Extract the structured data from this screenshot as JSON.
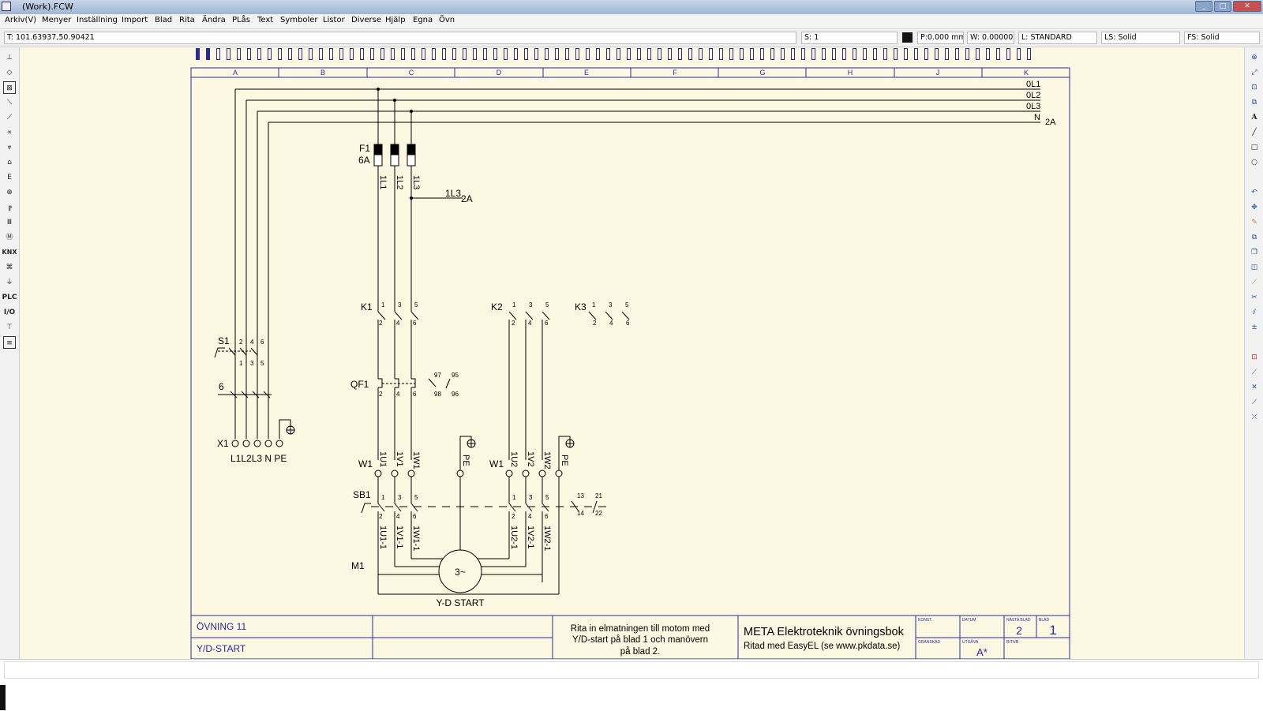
{
  "window": {
    "title": "(Work).FCW"
  },
  "menu": [
    "Arkiv(V)",
    "Menyer",
    "Inställning",
    "Import",
    "Blad",
    "Rita",
    "Ändra",
    "PLås",
    "Text",
    "Symboler",
    "Listor",
    "Diverse",
    "Hjälp",
    "Egna",
    "Övn"
  ],
  "status": {
    "coord": "T: 101.63937,50.90421",
    "scale": "S: 1",
    "pen": "P:0.000 mm",
    "width": "W: 0.00000",
    "layer": "L: STANDARD",
    "line_style": "LS: Solid",
    "fill_style": "FS: Solid"
  },
  "left_tools": [
    "pin-icon",
    "component-icon",
    "terminal-icon",
    "switch-icon",
    "contact-icon",
    "relay-icon",
    "fuse-icon",
    "lamp-icon",
    "transformer-icon",
    "socket-icon",
    "busbar-icon",
    "terminal-strip-icon",
    "motor-icon",
    "KNX",
    "sensor-icon",
    "plug-icon",
    "PLC",
    "I/O",
    "connector-icon",
    "list-icon"
  ],
  "right_tools": [
    "zoom-in-icon",
    "zoom-fit-icon",
    "zoom-window-icon",
    "zoom-prev-icon",
    "text-icon",
    "line-icon",
    "rectangle-icon",
    "circle-icon",
    "undo-icon",
    "move-icon",
    "pencil-icon",
    "copy-icon",
    "duplicate-icon",
    "mirror-icon",
    "measure-icon",
    "trim-icon",
    "split-icon",
    "numbering-icon",
    "snap-icon",
    "snap-end-icon",
    "snap-intersect-icon",
    "snap-near-icon",
    "snap-off-icon"
  ],
  "drawing": {
    "columns": [
      "A",
      "B",
      "C",
      "D",
      "E",
      "F",
      "G",
      "H",
      "J",
      "K"
    ],
    "bus_labels": [
      "0L1",
      "0L2",
      "0L3",
      "N"
    ],
    "bus_rating": "2A",
    "fuse_tag": "F1",
    "fuse_rating": "6A",
    "fuse_outputs": [
      "1L1",
      "1L2",
      "1L3"
    ],
    "branch_label": "1L3",
    "branch_rating": "2A",
    "k1": "K1",
    "k2": "K2",
    "k3": "K3",
    "top_nums": [
      "1",
      "3",
      "5"
    ],
    "bottom_nums": [
      "2",
      "4",
      "6"
    ],
    "s1": "S1",
    "s1_top_nums": [
      "2",
      "4",
      "6"
    ],
    "s1_bottom_nums": [
      "1",
      "3",
      "5"
    ],
    "s1_size": "6",
    "qf1": "QF1",
    "qf_aux_top": [
      "97",
      "95"
    ],
    "qf_aux_bottom": [
      "98",
      "96"
    ],
    "x1": "X1",
    "x1_labels": "L1L2L3 N PE",
    "w1": "W1",
    "w1_left_terms": [
      "1U1",
      "1V1",
      "1W1",
      "PE"
    ],
    "w1_right_terms": [
      "1U2",
      "1V2",
      "1W2",
      "PE"
    ],
    "sb1": "SB1",
    "sb1_aux_top": [
      "13",
      "21"
    ],
    "sb1_aux_bottom": [
      "14",
      "22"
    ],
    "motor_left_wires": [
      "1U1-1",
      "1V1-1",
      "1W1-1"
    ],
    "motor_right_wires": [
      "1U2-1",
      "1V2-1",
      "1W2-1"
    ],
    "m1": "M1",
    "motor_symbol": "3~",
    "motor_caption": "Y-D START"
  },
  "titleblock": {
    "exercise": "ÖVNING 11",
    "subject": "Y/D-START",
    "description_lines": [
      "Rita in elmatningen till motom med",
      "Y/D-start på blad 1 och manövern",
      "på blad 2."
    ],
    "book_title": "META Elektroteknik övningsbok",
    "drawn_with": "Ritad med EasyEL (se www.pkdata.se)",
    "konst_label": "KONST.",
    "datum_label": "DATUM",
    "nasta_blad_label": "NÄSTA BLAD",
    "blad_label": "BLAD",
    "nasta_blad": "2",
    "blad": "1",
    "granskad_label": "GRANSKAD",
    "utgava_label": "UTGÅVA",
    "ritnr_label": "RITNR",
    "utgava": "A*"
  },
  "colors": {
    "paper": "#fdf8e1",
    "frame": "#2a2aa0",
    "wire": "#000000",
    "titlebar": "#a9bddb"
  }
}
